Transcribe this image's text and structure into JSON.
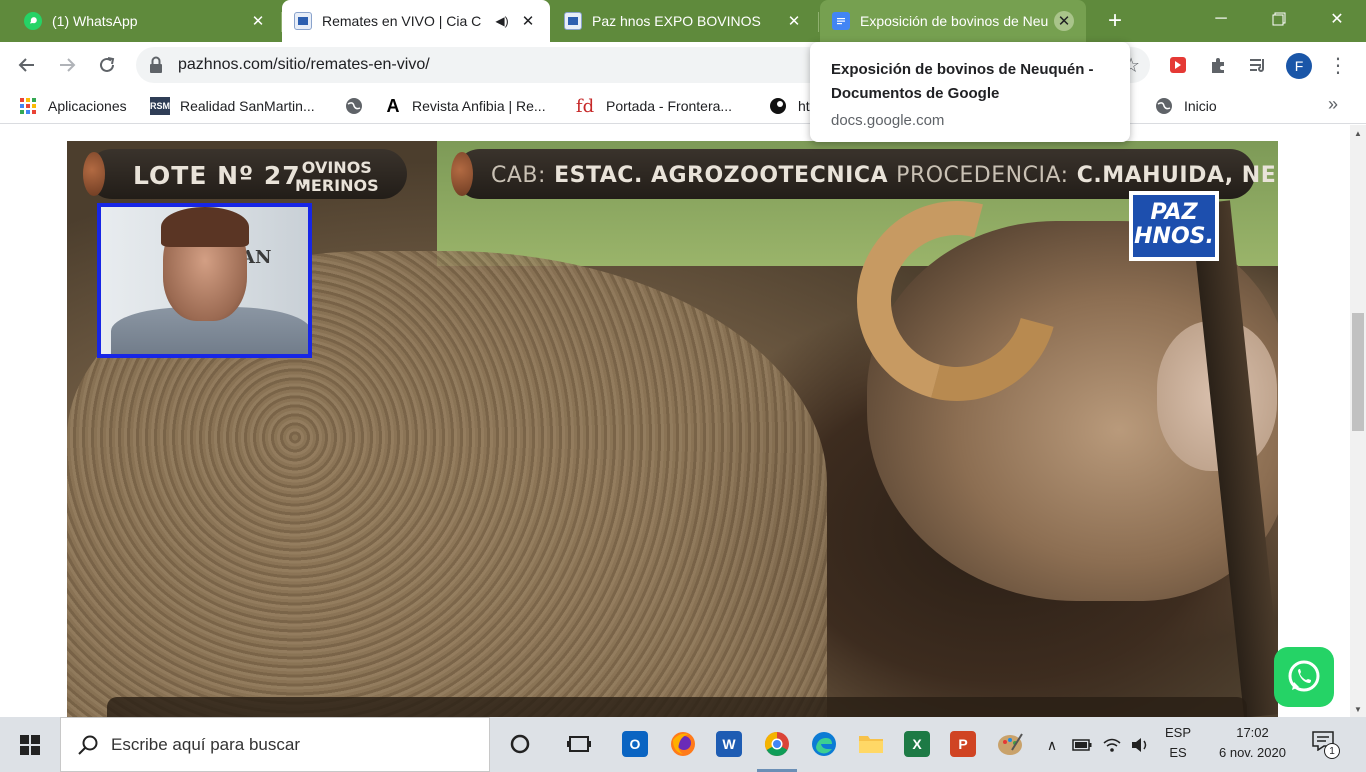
{
  "browser": {
    "tabs": [
      {
        "title": "(1) WhatsApp",
        "state": "inactive",
        "icon": "whatsapp-icon"
      },
      {
        "title": "Remates en VIVO | Cia C",
        "state": "active",
        "icon": "pazhnos-favicon"
      },
      {
        "title": "Paz hnos EXPO BOVINOS",
        "state": "inactive",
        "icon": "pazhnos-favicon"
      },
      {
        "title": "Exposición de bovinos de Neuquén",
        "state": "hover",
        "icon": "google-docs-icon"
      }
    ],
    "url": "pazhnos.com/sitio/remates-en-vivo/",
    "profile_initial": "F",
    "bookmarks": [
      {
        "label": "Aplicaciones",
        "icon": "apps-grid-icon"
      },
      {
        "label": "Realidad SanMartin...",
        "icon": "rsm-icon"
      },
      {
        "label": "",
        "icon": "globe-icon"
      },
      {
        "label": "Revista Anfibia | Re...",
        "icon": "anfibia-icon"
      },
      {
        "label": "Portada - Frontera...",
        "icon": "fd-icon"
      },
      {
        "label": "ht",
        "icon": "circle-icon"
      },
      {
        "label": "Inicio",
        "icon": "globe-icon"
      }
    ],
    "tooltip": {
      "title": "Exposición de bovinos de Neuquén - Documentos de Google",
      "url": "docs.google.com"
    }
  },
  "video": {
    "lot": "LOTE Nº 27.",
    "category_line1": "OVINOS",
    "category_line2": "MERINOS",
    "cab_label": "CAB:",
    "cab_value": "ESTAC. AGROZOOTECNICA",
    "origin_label": "PROCEDENCIA:",
    "origin_value": "C.MAHUIDA, NEUQUÉN",
    "logo_line1": "PAZ",
    "logo_line2": "HNOS.",
    "pip_sign": "AN"
  },
  "taskbar": {
    "search_placeholder": "Escribe aquí para buscar",
    "lang_line1": "ESP",
    "lang_line2": "ES",
    "time": "17:02",
    "date": "6 nov. 2020",
    "notification_count": "1"
  },
  "colors": {
    "tabstrip": "#5f8a3c",
    "whatsapp": "#25d366",
    "pip_border": "#1726e6",
    "logo_blue": "#1d4fae"
  }
}
